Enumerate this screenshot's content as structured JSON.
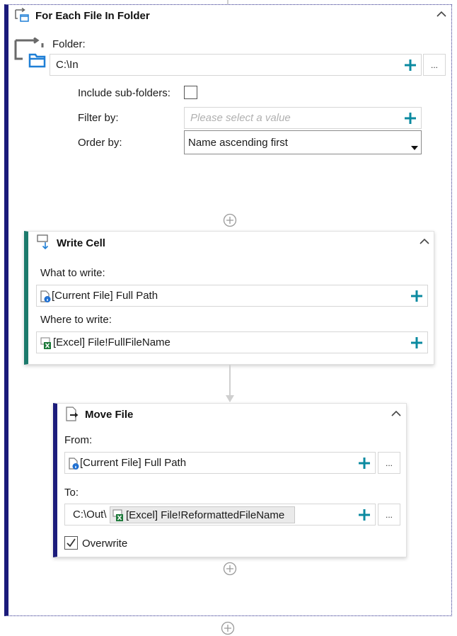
{
  "colors": {
    "accent_plus": "#0b8aa0",
    "loop_border": "#1b1b7a",
    "write_cell_border": "#1c7a6c",
    "folder_icon": "#1f7fd6"
  },
  "loop": {
    "title": "For Each File In Folder",
    "folder_label": "Folder:",
    "folder_value": "C:\\In",
    "browse_label": "...",
    "include_subfolders_label": "Include sub-folders:",
    "include_subfolders_checked": false,
    "filter_label": "Filter by:",
    "filter_placeholder": "Please select a value",
    "order_label": "Order by:",
    "order_value": "Name ascending first"
  },
  "write_cell": {
    "title": "Write Cell",
    "what_label": "What to write:",
    "what_value": "[Current File] Full Path",
    "where_label": "Where to write:",
    "where_value": "[Excel] File!FullFileName"
  },
  "move_file": {
    "title": "Move File",
    "from_label": "From:",
    "from_value": "[Current File] Full Path",
    "from_browse": "...",
    "to_label": "To:",
    "to_prefix": "C:\\Out\\",
    "to_token": "[Excel] File!ReformattedFileName",
    "to_browse": "...",
    "overwrite_label": "Overwrite",
    "overwrite_checked": true
  }
}
